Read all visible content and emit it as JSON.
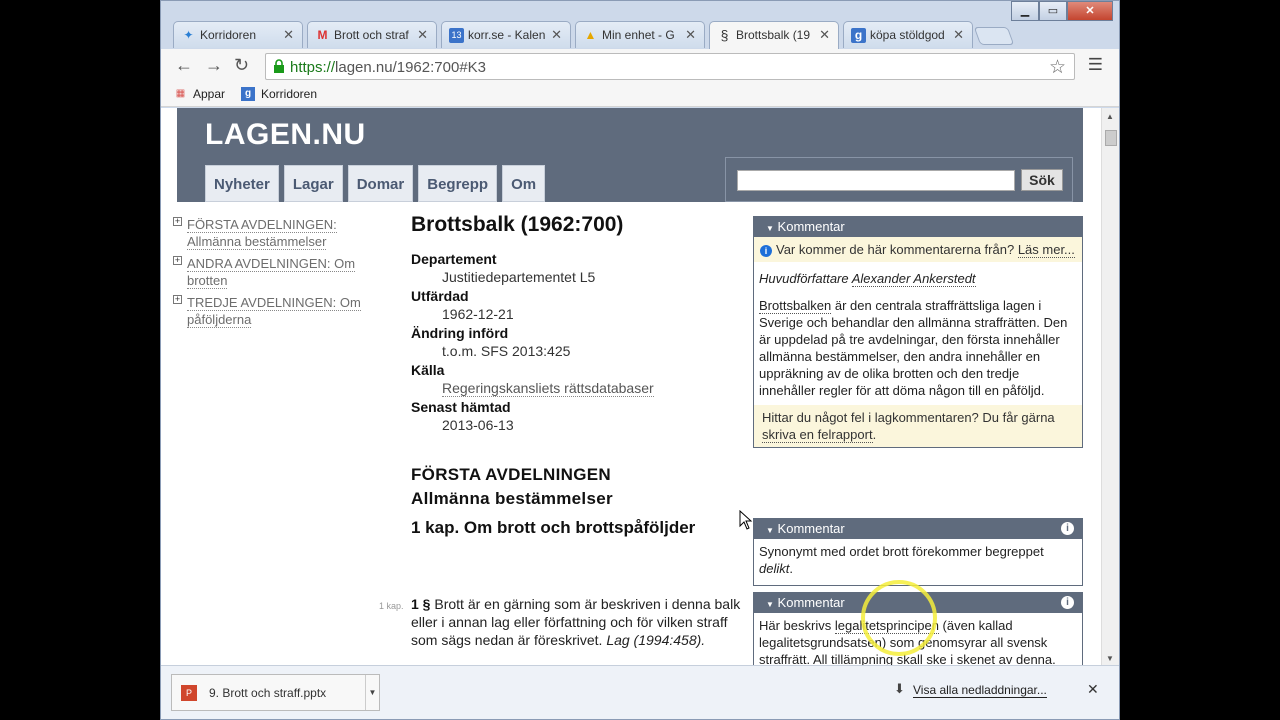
{
  "browser": {
    "tabs": [
      {
        "label": "Korridoren",
        "icon": "korridoren-favicon",
        "active": false
      },
      {
        "label": "Brott och straf",
        "icon": "gmail-favicon",
        "active": false
      },
      {
        "label": "korr.se - Kalen",
        "icon": "calendar-favicon",
        "active": false
      },
      {
        "label": "Min enhet - G",
        "icon": "drive-favicon",
        "active": false
      },
      {
        "label": "Brottsbalk (19",
        "icon": "paragraph-favicon",
        "active": true
      },
      {
        "label": "köpa stöldgod",
        "icon": "google-favicon",
        "active": false
      }
    ],
    "url_scheme": "https://",
    "url_rest": "lagen.nu/1962:700#K3",
    "bookmarks": [
      {
        "label": "Appar",
        "icon": "apps-grid-icon"
      },
      {
        "label": "Korridoren",
        "icon": "google-favicon"
      }
    ]
  },
  "site": {
    "logo": "LAGEN.NU",
    "nav": [
      "Nyheter",
      "Lagar",
      "Domar",
      "Begrepp",
      "Om"
    ],
    "search_button": "Sök"
  },
  "toc": [
    {
      "line1": "FÖRSTA AVDELNINGEN:",
      "line2": "Allmänna bestämmelser"
    },
    {
      "line1": "ANDRA AVDELNINGEN: Om",
      "line2": "brotten"
    },
    {
      "line1": "TREDJE AVDELNINGEN: Om",
      "line2": "påföljderna"
    }
  ],
  "document": {
    "title": "Brottsbalk (1962:700)",
    "meta": [
      {
        "label": "Departement",
        "value": "Justitiedepartementet L5"
      },
      {
        "label": "Utfärdad",
        "value": "1962-12-21"
      },
      {
        "label": "Ändring införd",
        "value": "t.o.m. SFS 2013:425"
      },
      {
        "label": "Källa",
        "value": "Regeringskansliets rättsdatabaser"
      },
      {
        "label": "Senast hämtad",
        "value": "2013-06-13"
      }
    ],
    "section_title": "FÖRSTA AVDELNINGEN",
    "section_subtitle": "Allmänna bestämmelser",
    "chapter": "1 kap. Om brott och brottspåföljder",
    "para_label": "1 kap.",
    "para_num": "1 §",
    "para_text": " Brott är en gärning som är beskriven i denna balk eller i annan lag eller författning och för vilken straff som sägs nedan är föreskrivet. ",
    "para_ref": "Lag (1994:458)."
  },
  "comments": [
    {
      "head": "Kommentar",
      "note_pre": "Var kommer de här kommentarerna från? ",
      "note_link": "Läs mer...",
      "author_pre": "Huvudförfattare ",
      "author": "Alexander Ankerstedt",
      "body_link": "Brottsbalken",
      "body": " är den centrala straffrättsliga lagen i Sverige och behandlar den allmänna straffrätten. Den är uppdelad på tre avdelningar, den första innehåller allmänna bestämmelser, den andra innehåller en uppräkning av de olika brotten och den tredje innehåller regler för att döma någon till en påföljd.",
      "footer_pre": "Hittar du något fel i lagkommentaren? Du får gärna ",
      "footer_link": "skriva en felrapport",
      "footer_post": "."
    },
    {
      "head": "Kommentar",
      "body_pre": "Synonymt med ordet brott förekommer begreppet ",
      "body_em": "delikt",
      "body_post": "."
    },
    {
      "head": "Kommentar",
      "body_pre": "Här beskrivs ",
      "body_link": "legalitetsprincipen",
      "body_post": " (även kallad legalitetsgrundsatsen) som genomsyrar all svensk straffrätt. All tillämpning skall ske i skenet av denna."
    }
  ],
  "downloads": {
    "file": "9. Brott och straff.pptx",
    "show_all": "Visa alla nedladdningar..."
  }
}
